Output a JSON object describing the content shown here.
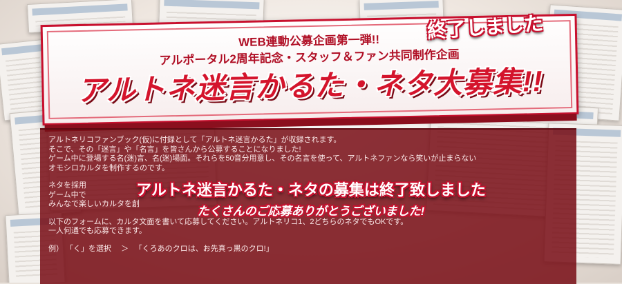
{
  "banner": {
    "line1": "WEB連動公募企画第一弾!!",
    "line2": "アルポータル2周年記念・スタッフ＆ファン共同制作企画",
    "title": "アルトネ迷言かるた・ネタ大募集!!",
    "ended_stamp": "終了しました"
  },
  "body": {
    "p1": "アルトネリコファンブック(仮)に付録として「アルトネ迷言かるた」が収録されます。",
    "p2": "そこで、その「迷言」や「名言」を皆さんから公募することになりました!",
    "p3": "ゲーム中に登場する名(迷)言、名(迷)場面。それらを50音分用意し、その名言を使って、アルトネファンなら笑いが止まらない",
    "p4": "オモシロカルタを制作するのです。",
    "p5": "ネタを採用",
    "p6": "ゲーム中で",
    "p7": "みんなで楽しいカルタを創",
    "p8": "以下のフォームに、カルタ文面を書いて応募してください。アルトネリコ1、2どちらのネタでもOKです。",
    "p9": "一人何通でも応募できます。",
    "example": "例） 「く」を選択　 ＞ 　「くろあのクロは、お先真っ黒のクロ!」"
  },
  "overlay": {
    "line1": "アルトネ迷言かるた・ネタの募集は終了致しました",
    "line2": "たくさんのご応募ありがとうございました!"
  },
  "colors": {
    "accent_red": "#c8102e",
    "panel": "#7a0e16"
  }
}
